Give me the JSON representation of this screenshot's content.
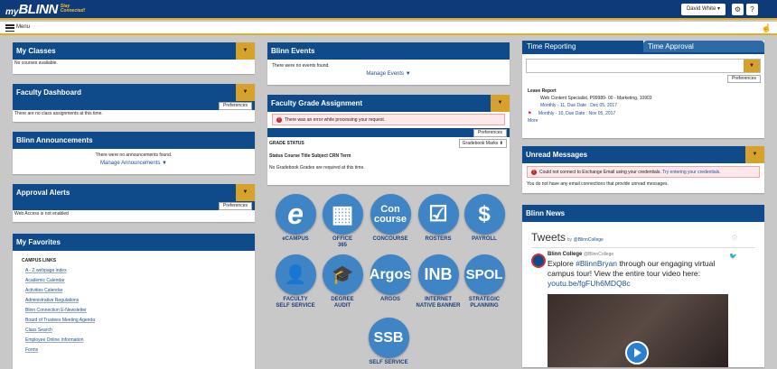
{
  "app": {
    "logo_my": "my",
    "logo_blinn": "BLINN",
    "tagline_1": "Stay",
    "tagline_2": "Connected!"
  },
  "header": {
    "user_label": "David White ▾",
    "settings_icon": "gear-icon",
    "help_icon": "question-icon"
  },
  "menu": {
    "label": "Menu",
    "menu_icon": "hamburger-icon",
    "corner_icon": "hand-cursor-icon"
  },
  "my_classes": {
    "title": "My Classes",
    "empty": "No courses available."
  },
  "faculty_dashboard": {
    "title": "Faculty Dashboard",
    "preferences": "Preferences",
    "empty": "There are no class assignments at this time."
  },
  "announcements": {
    "title": "Blinn Announcements",
    "empty": "There were no announcements found.",
    "manage": "Manage Announcements ▼"
  },
  "approval_alerts": {
    "title": "Approval Alerts",
    "preferences": "Preferences",
    "text": "Web Access is not enabled"
  },
  "favorites": {
    "title": "My Favorites",
    "section": "CAMPUS LINKS",
    "links": [
      "A - Z webpage index",
      "Academic Calendar",
      "Activities Calendar",
      "Administrative Regulations",
      "Blinn Connection E-Newsletter",
      "Board of Trustees Meeting Agenda",
      "Class Search",
      "Employee Online Information",
      "Forms"
    ]
  },
  "events": {
    "title": "Blinn Events",
    "empty": "There were no events found.",
    "manage": "Manage Events ▼"
  },
  "grade_assignment": {
    "title": "Faculty Grade Assignment",
    "error": "There was an error while processing your request.",
    "preferences": "Preferences",
    "grade_status": "GRADE STATUS",
    "dropdown": "Gradebook Marks ⬍",
    "columns": "Status Course Title Subject CRN Term",
    "empty": "No Gradebook Grades are required at this time."
  },
  "tiles": [
    {
      "glyph": "e",
      "label_1": "eCAMPUS",
      "label_2": ""
    },
    {
      "glyph": "▦",
      "label_1": "OFFICE",
      "label_2": "365"
    },
    {
      "glyph": "Con course",
      "label_1": "CONCOURSE",
      "label_2": ""
    },
    {
      "glyph": "☑",
      "label_1": "ROSTERS",
      "label_2": ""
    },
    {
      "glyph": "$",
      "label_1": "PAYROLL",
      "label_2": ""
    },
    {
      "glyph": "👤",
      "label_1": "FACULTY",
      "label_2": "SELF SERVICE"
    },
    {
      "glyph": "🎓",
      "label_1": "DEGREE",
      "label_2": "AUDIT"
    },
    {
      "glyph": "Argos",
      "label_1": "ARGOS",
      "label_2": ""
    },
    {
      "glyph": "INB",
      "label_1": "INTERNET",
      "label_2": "NATIVE BANNER"
    },
    {
      "glyph": "SPOL",
      "label_1": "STRATEGIC",
      "label_2": "PLANNING"
    },
    {
      "glyph": "SSB",
      "label_1": "SELF SERVICE",
      "label_2": ""
    }
  ],
  "time": {
    "tab_1": "Time Reporting",
    "tab_2": "Time Approval",
    "preferences": "Preferences",
    "leave_title": "Leave Report",
    "leave_detail": "Web Content Specialist,  P99989- 00  -  Marketing, 10903",
    "entry_1": "Monthly - 11, Due Date : Dec 05, 2017",
    "entry_2": "Monthly - 10, Due Date : Nov 05, 2017",
    "more": "More",
    "accent_tab": "#0f4a8a",
    "inactive_tab": "#2c6aa8"
  },
  "unread": {
    "title": "Unread Messages",
    "error": "Could not connect to Exchange Email using your credentials.",
    "error_link": "Try entering your credentials.",
    "text": "You do not have any email connections that provide unread messages."
  },
  "news": {
    "title": "Blinn News",
    "tweets": "Tweets",
    "by": "by",
    "handle": "@BlinnCollege",
    "author": "Blinn College",
    "author_handle": "@BlinnCollege",
    "tweet_1": "Explore",
    "tweet_hashtag": "#BlinnBryan",
    "tweet_2": "through our engaging virtual",
    "tweet_3": "campus tour! View the entire tour video here:",
    "tweet_url": "youtu.be/fgFUh6MDQ8c"
  },
  "colors": {
    "navy": "#0f4a8a",
    "gold": "#d6a22c",
    "tile_blue": "#3f84c4",
    "error_red": "#c0272d"
  }
}
